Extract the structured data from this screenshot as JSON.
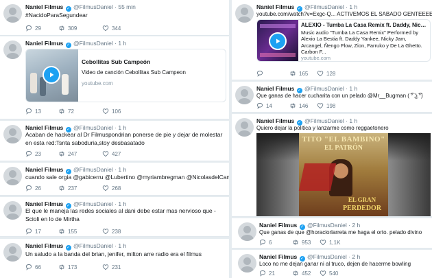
{
  "colors": {
    "accent": "#1da1f2",
    "muted": "#657786",
    "background": "#e6ecf0",
    "like_red": "#e0245e"
  },
  "icons": {
    "reply": "reply-icon",
    "retweet": "retweet-icon",
    "like": "heart-icon",
    "verified": "verified-badge-icon",
    "play": "play-icon"
  },
  "left": {
    "tweets": [
      {
        "name": "Naniel Filmus",
        "handle": "@FilmusDaniel",
        "time": "55 min",
        "text": "#NacidoParaSegundear",
        "replies": "29",
        "retweets": "309",
        "likes": "344"
      },
      {
        "name": "Naniel Filmus",
        "handle": "@FilmusDaniel",
        "time": "1 h",
        "card": {
          "title": "Cebollitas Sub Campeón",
          "description": "Video de canción Cebollitas Sub Campeon",
          "domain": "youtube.com"
        },
        "replies": "13",
        "retweets": "72",
        "likes": "106"
      },
      {
        "name": "Naniel Filmus",
        "handle": "@FilmusDaniel",
        "time": "1 h",
        "text": "Acaban de hackear al Dr Filmuspondrian ponerse de pie y dejar de molestar en esta red:Tsnta saboduria,stoy desbasatado",
        "replies": "23",
        "retweets": "247",
        "likes": "427"
      },
      {
        "name": "Naniel Filmus",
        "handle": "@FilmusDaniel",
        "time": "1 h",
        "text": "cuando sale orgia @gabicerru @Lubertino @myriambregman @NicolasdelCano",
        "replies": "26",
        "retweets": "237",
        "likes": "268"
      },
      {
        "name": "Naniel Filmus",
        "handle": "@FilmusDaniel",
        "time": "1 h",
        "text": "El que le maneja las redes sociales al dani debe estar mas nervioso que -Scioli en lo de Mirtha",
        "replies": "17",
        "retweets": "155",
        "likes": "238"
      },
      {
        "name": "Naniel Filmus",
        "handle": "@FilmusDaniel",
        "time": "1 h",
        "text": "Un saludo a la banda del brian, jenifer, milton arre radio era el filmus",
        "replies": "66",
        "retweets": "173",
        "likes": "231"
      }
    ]
  },
  "right": {
    "tweets": [
      {
        "name": "Naniel Filmus",
        "handle": "@FilmusDaniel",
        "time": "1 h",
        "text": "youtube.com/watch?v=Exgc-Q...  ACTIVEMOS EL SABADO GENTEEEE",
        "card": {
          "title": "ALEXIO - Tumba La Casa Remix ft. Daddy, Nicky Ja...",
          "description": "Music audio \"Tumba La Casa Remix\" Performed by Alexio La Bestia ft. Daddy Yankee, Nicky Jam, Arcangel, Ñengo Flow, Zion, Farruko y De La Ghetto. Carbon F...",
          "domain": "youtube.com"
        },
        "replies": "",
        "retweets": "165",
        "likes": "128"
      },
      {
        "name": "Naniel Filmus",
        "handle": "@FilmusDaniel",
        "time": "1 h",
        "text": "Que ganas de hacer cucharita con un pelado @Mr__Bugman ( ͡° ͜ʖ ͡°)",
        "replies": "14",
        "retweets": "146",
        "likes": "198"
      },
      {
        "name": "Naniel Filmus",
        "handle": "@FilmusDaniel",
        "time": "1 h",
        "text": "Quiero dejar la politica y lanzarme como reggaetonero",
        "image": {
          "line1": "TITO \"EL BAMBINO\"",
          "line2": "EL PATRÓN",
          "line3": "EL GRAN",
          "line4": "PERDEDOR"
        }
      },
      {
        "name": "Naniel Filmus",
        "handle": "@FilmusDaniel",
        "time": "2 h",
        "text": "Que ganas de que @horaciorlarreta me haga el orto. pelado divino",
        "replies": "6",
        "retweets": "953",
        "likes": "1,1K"
      },
      {
        "name": "Naniel Filmus",
        "handle": "@FilmusDaniel",
        "time": "2 h",
        "text": "Loco no me dejan ganar ni al truco, dejen de hacerme bowling",
        "replies": "21",
        "retweets": "452",
        "likes": "540"
      }
    ]
  }
}
